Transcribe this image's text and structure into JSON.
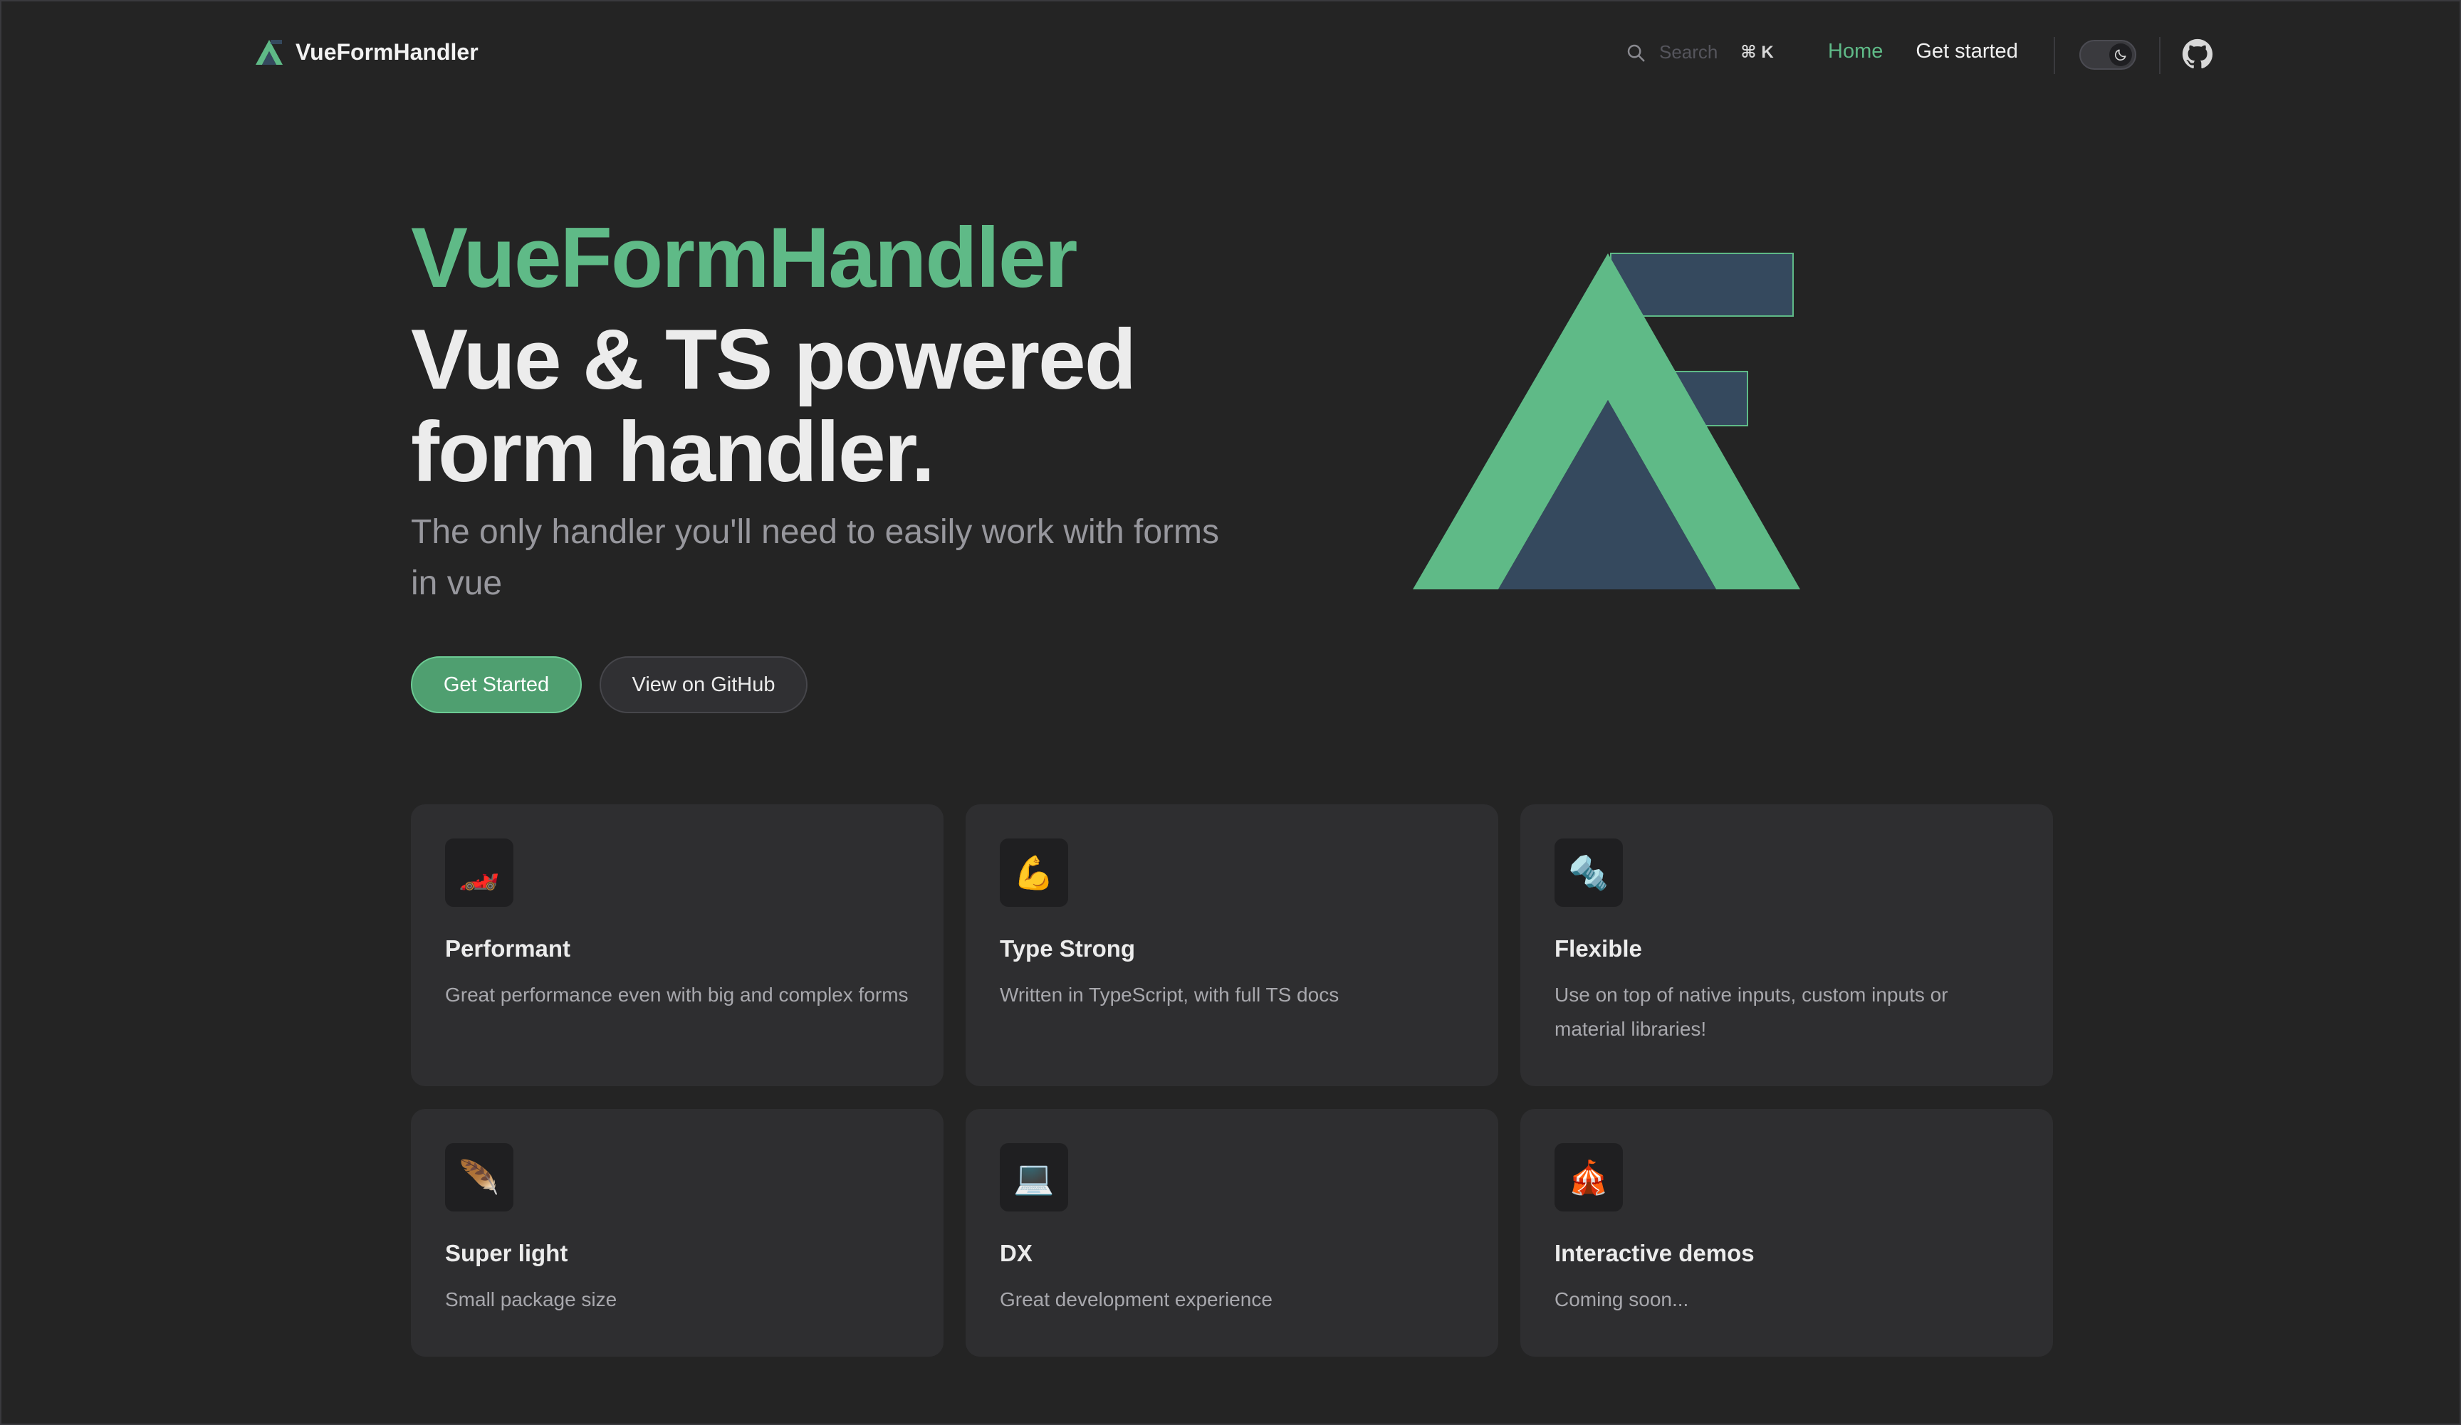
{
  "nav": {
    "brand": "VueFormHandler",
    "search_placeholder": "Search",
    "search_shortcut": "⌘ K",
    "links": [
      "Home",
      "Get started"
    ],
    "active_link": "Home",
    "theme_toggle_icon": "moon-icon",
    "github_icon": "github-icon"
  },
  "hero": {
    "name": "VueFormHandler",
    "text": "Vue & TS powered form handler.",
    "tagline": "The only handler you'll need to easily work with forms in vue",
    "primary_button": "Get Started",
    "secondary_button": "View on GitHub"
  },
  "features": [
    {
      "icon": "🏎️",
      "icon_name": "race-car-icon",
      "title": "Performant",
      "details": "Great performance even with big and complex forms"
    },
    {
      "icon": "💪",
      "icon_name": "flexed-biceps-icon",
      "title": "Type Strong",
      "details": "Written in TypeScript, with full TS docs"
    },
    {
      "icon": "🔩",
      "icon_name": "nut-and-bolt-icon",
      "title": "Flexible",
      "details": "Use on top of native inputs, custom inputs or material libraries!"
    },
    {
      "icon": "🪶",
      "icon_name": "feather-icon",
      "title": "Super light",
      "details": "Small package size"
    },
    {
      "icon": "💻",
      "icon_name": "laptop-icon",
      "title": "DX",
      "details": "Great development experience"
    },
    {
      "icon": "🎪",
      "icon_name": "circus-tent-icon",
      "title": "Interactive demos",
      "details": "Coming soon..."
    }
  ],
  "colors": {
    "brand_green": "#5fba87",
    "brand_navy": "#35495e",
    "background": "#242424",
    "card": "#2e2e30"
  }
}
